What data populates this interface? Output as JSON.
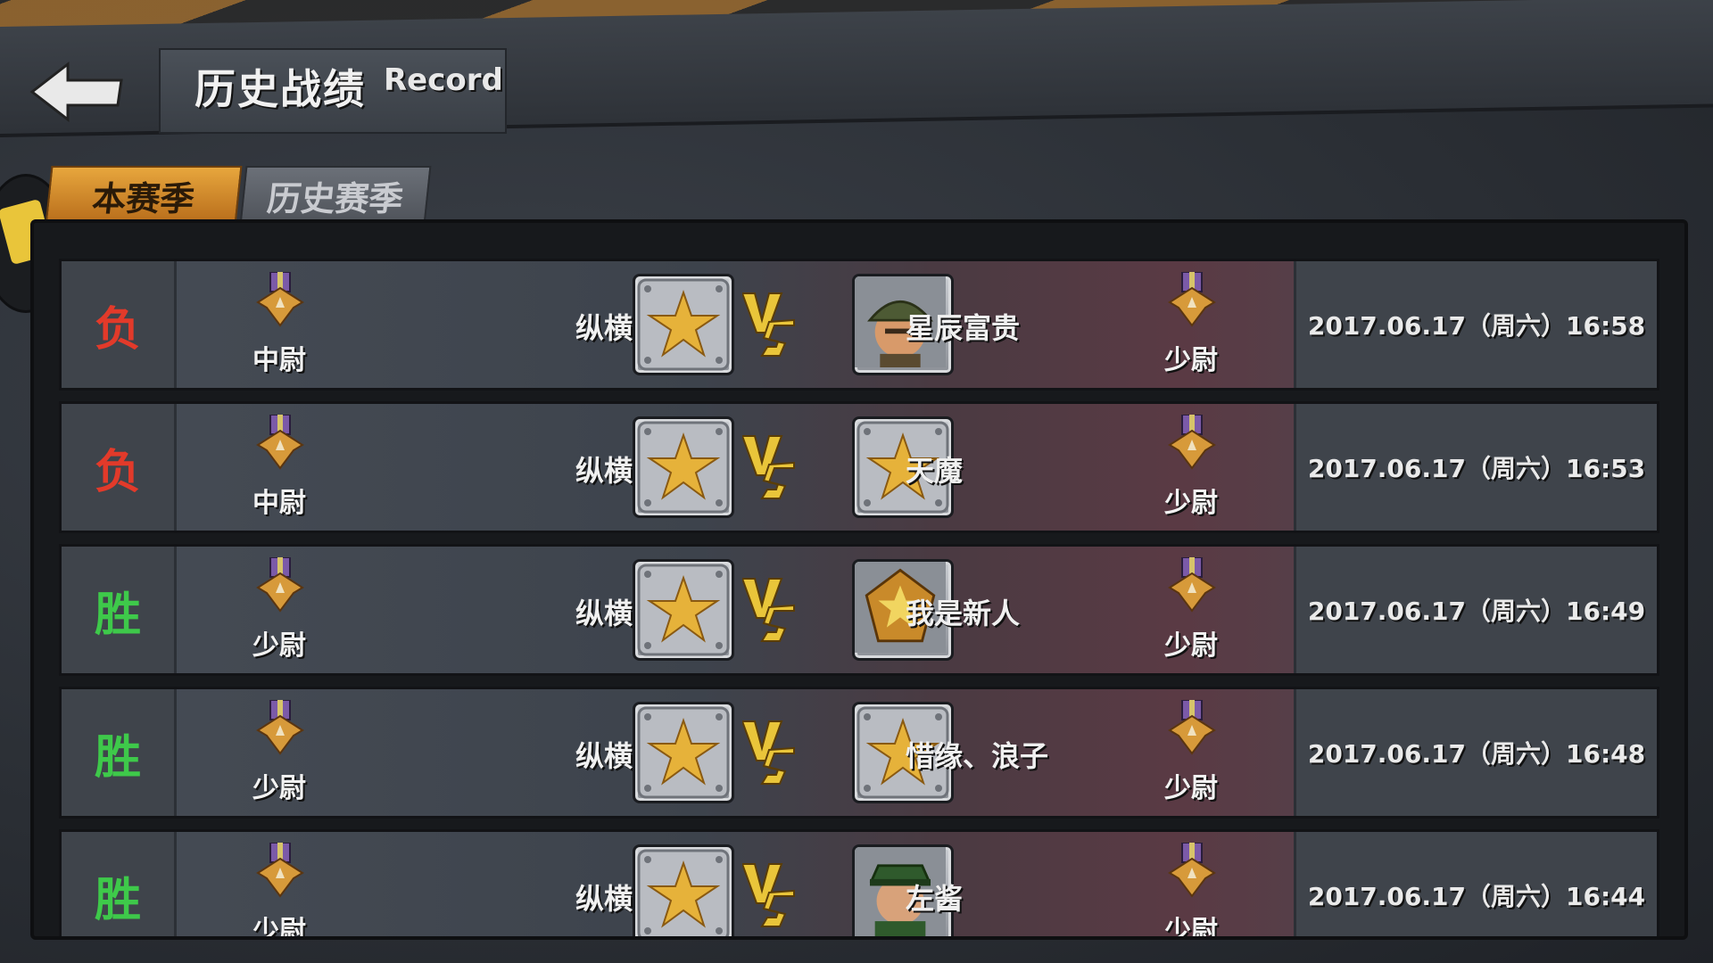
{
  "header": {
    "title": "历史战绩",
    "title_en": "Record"
  },
  "tabs": [
    {
      "label": "本赛季",
      "active": true
    },
    {
      "label": "历史赛季",
      "active": false
    }
  ],
  "records": [
    {
      "result": "负",
      "result_type": "lose",
      "my_rank": "中尉",
      "my_name": "纵横",
      "opp_name": "星辰富贵",
      "opp_avatar": "helmet-soldier",
      "opp_rank": "少尉",
      "time": "2017.06.17（周六）16:58"
    },
    {
      "result": "负",
      "result_type": "lose",
      "my_rank": "中尉",
      "my_name": "纵横",
      "opp_name": "天魔",
      "opp_avatar": "star-badge",
      "opp_rank": "少尉",
      "time": "2017.06.17（周六）16:53"
    },
    {
      "result": "胜",
      "result_type": "win",
      "my_rank": "少尉",
      "my_name": "纵横",
      "opp_name": "我是新人",
      "opp_avatar": "gold-emblem",
      "opp_rank": "少尉",
      "time": "2017.06.17（周六）16:49"
    },
    {
      "result": "胜",
      "result_type": "win",
      "my_rank": "少尉",
      "my_name": "纵横",
      "opp_name": "惜缘、浪子",
      "opp_avatar": "star-badge",
      "opp_rank": "少尉",
      "time": "2017.06.17（周六）16:48"
    },
    {
      "result": "胜",
      "result_type": "win",
      "my_rank": "少尉",
      "my_name": "纵横",
      "opp_name": "左酱",
      "opp_avatar": "general-officer",
      "opp_rank": "少尉",
      "time": "2017.06.17（周六）16:44"
    }
  ],
  "colors": {
    "lose": "#e23a2a",
    "win": "#3ec94a",
    "tab_active": "#e7a63d"
  }
}
